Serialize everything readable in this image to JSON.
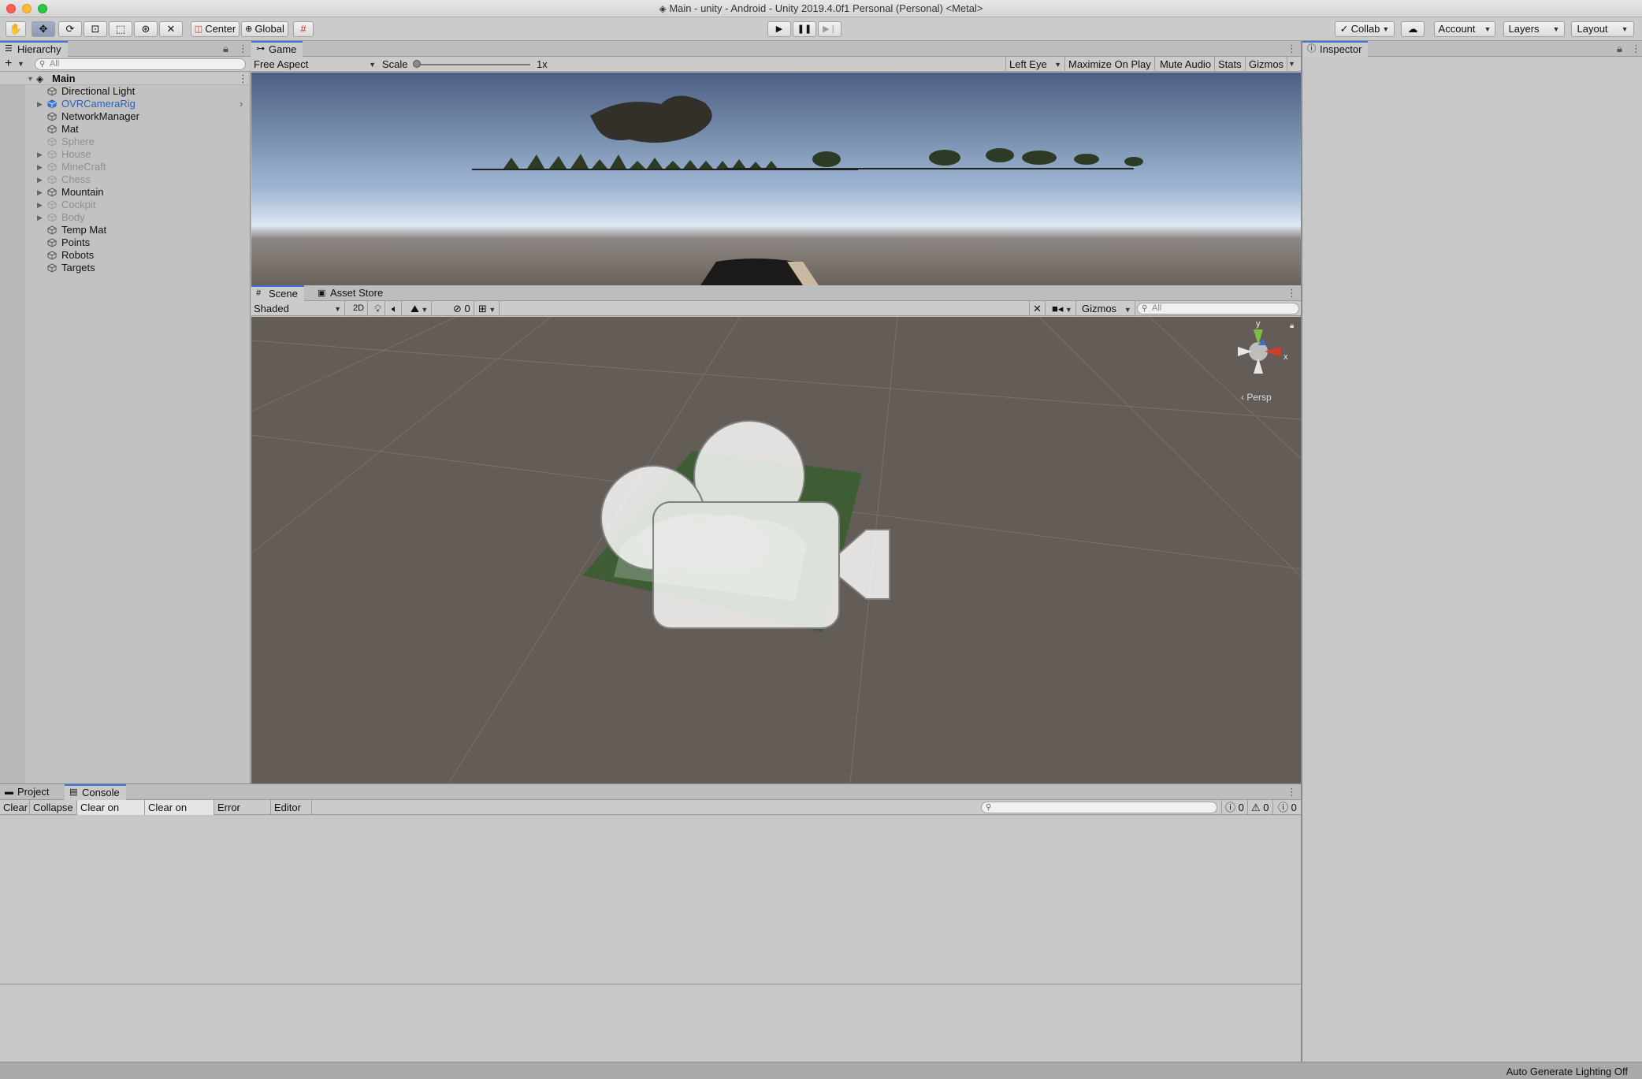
{
  "window": {
    "title": "Main - unity - Android - Unity 2019.4.0f1 Personal (Personal) <Metal>"
  },
  "toolbar": {
    "tools": [
      "hand-tool",
      "move-tool",
      "rotate-tool",
      "scale-tool",
      "rect-tool",
      "transform-tool",
      "custom-tool"
    ],
    "pivot_label": "Center",
    "space_label": "Global",
    "collab_label": "Collab",
    "account_label": "Account",
    "layers_label": "Layers",
    "layout_label": "Layout"
  },
  "hierarchy": {
    "tab_label": "Hierarchy",
    "search_placeholder": "All",
    "scene_name": "Main",
    "items": [
      {
        "label": "Directional Light",
        "state": "active",
        "expandable": false
      },
      {
        "label": "OVRCameraRig",
        "state": "prefab",
        "expandable": true
      },
      {
        "label": "NetworkManager",
        "state": "active",
        "expandable": false
      },
      {
        "label": "Mat",
        "state": "active",
        "expandable": false
      },
      {
        "label": "Sphere",
        "state": "inactive",
        "expandable": false
      },
      {
        "label": "House",
        "state": "inactive",
        "expandable": true
      },
      {
        "label": "MineCraft",
        "state": "inactive",
        "expandable": true
      },
      {
        "label": "Chess",
        "state": "inactive",
        "expandable": true
      },
      {
        "label": "Mountain",
        "state": "active",
        "expandable": true
      },
      {
        "label": "Cockpit",
        "state": "inactive",
        "expandable": true
      },
      {
        "label": "Body",
        "state": "inactive",
        "expandable": true
      },
      {
        "label": "Temp Mat",
        "state": "active",
        "expandable": false
      },
      {
        "label": "Points",
        "state": "active",
        "expandable": false
      },
      {
        "label": "Robots",
        "state": "active",
        "expandable": false
      },
      {
        "label": "Targets",
        "state": "active",
        "expandable": false
      }
    ]
  },
  "game": {
    "tab_label": "Game",
    "aspect_label": "Free Aspect",
    "scale_label": "Scale",
    "scale_value": "1x",
    "eye_label": "Left Eye",
    "maximize_label": "Maximize On Play",
    "mute_label": "Mute Audio",
    "stats_label": "Stats",
    "gizmos_label": "Gizmos"
  },
  "scene": {
    "tab_label": "Scene",
    "asset_store_label": "Asset Store",
    "shading_label": "Shaded",
    "mode_2d_label": "2D",
    "hidden_count": "0",
    "gizmos_label": "Gizmos",
    "search_placeholder": "All",
    "gizmo_y": "y",
    "gizmo_x": "x",
    "persp_label": "‹ Persp"
  },
  "console": {
    "project_tab": "Project",
    "console_tab": "Console",
    "buttons": [
      "Clear",
      "Collapse",
      "Clear on Play",
      "Clear on Build",
      "Error Pause",
      "Editor"
    ],
    "info_count": "0",
    "warn_count": "0",
    "error_count": "0"
  },
  "inspector": {
    "tab_label": "Inspector"
  },
  "statusbar": {
    "text": "Auto Generate Lighting Off"
  },
  "colors": {
    "accent": "#3a72d8",
    "prefab_text": "#2c5fb4",
    "inactive_text": "#8f8f8f",
    "scene_bg": "#645c57"
  }
}
